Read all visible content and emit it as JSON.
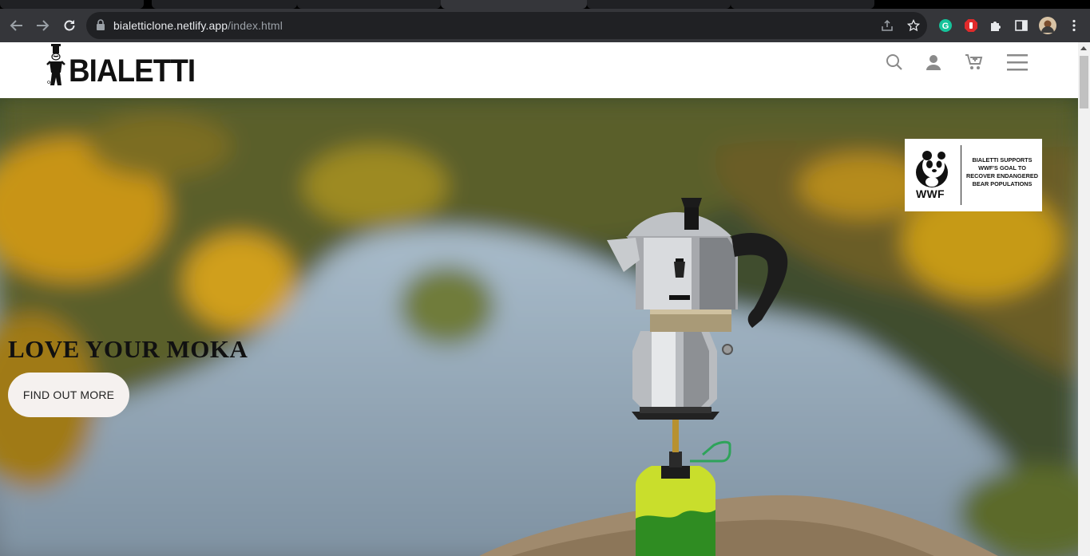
{
  "browser": {
    "url_host": "bialetticlone.netlify.app",
    "url_path": "/index.html"
  },
  "header": {
    "logo_text": "BIALETTI",
    "icons": [
      "search-icon",
      "user-icon",
      "cart-icon",
      "menu-icon"
    ]
  },
  "hero": {
    "title": "LOVE YOUR MOKA",
    "cta_label": "FIND OUT MORE"
  },
  "wwf_badge": {
    "label": "WWF",
    "text": "BIALETTI SUPPORTS WWF'S GOAL TO RECOVER ENDANGERED BEAR POPULATIONS"
  },
  "colors": {
    "chrome_toolbar": "#35363a",
    "omnibox": "#202124",
    "cta_background": "#f5f1ef",
    "header_icons": "#8a8a8a"
  }
}
